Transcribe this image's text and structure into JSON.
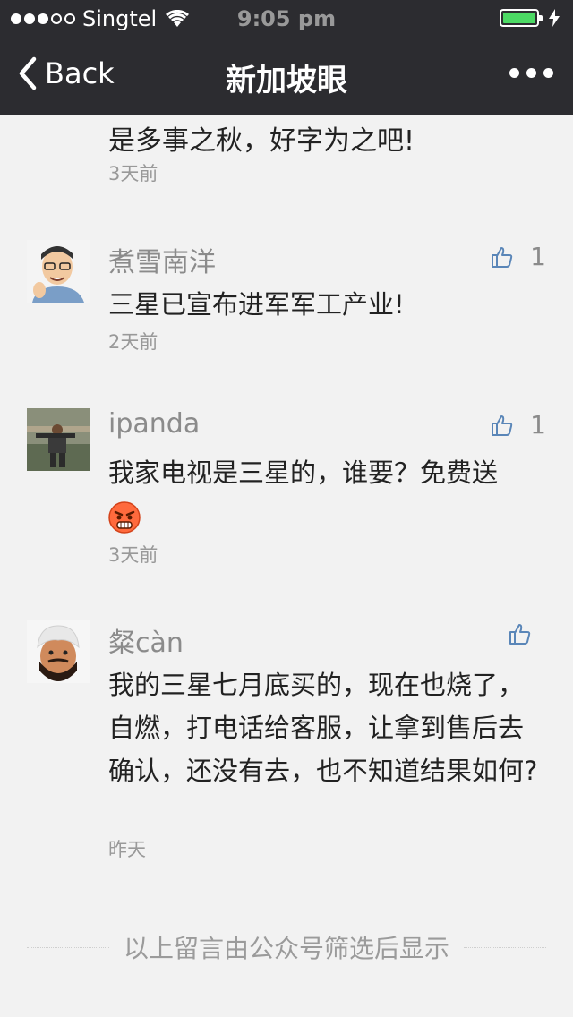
{
  "status_bar": {
    "carrier": "Singtel",
    "time": "9:05 pm",
    "signal_filled": 3,
    "signal_total": 5,
    "battery_level": 1.0,
    "battery_color": "#4cd964"
  },
  "nav": {
    "back_label": "Back",
    "title": "新加坡眼",
    "more_icon": "more-dots-icon"
  },
  "top_partial": {
    "text": "是多事之秋，好字为之吧!",
    "time": "3天前"
  },
  "comments": [
    {
      "name": "煮雪南洋",
      "likes": "1",
      "text": "三星已宣布进军军工产业!",
      "time": "2天前"
    },
    {
      "name": "ipanda",
      "likes": "1",
      "text": "我家电视是三星的，谁要？免费送",
      "emoji": "angry-face-emoji",
      "time": "3天前"
    },
    {
      "name": "粲càn",
      "likes": "",
      "text": "我的三星七月底买的，现在也烧了，自燃，打电话给客服，让拿到售后去确认，还没有去，也不知道结果如何?",
      "time": "昨天"
    }
  ],
  "footer": {
    "text": "以上留言由公众号筛选后显示"
  }
}
